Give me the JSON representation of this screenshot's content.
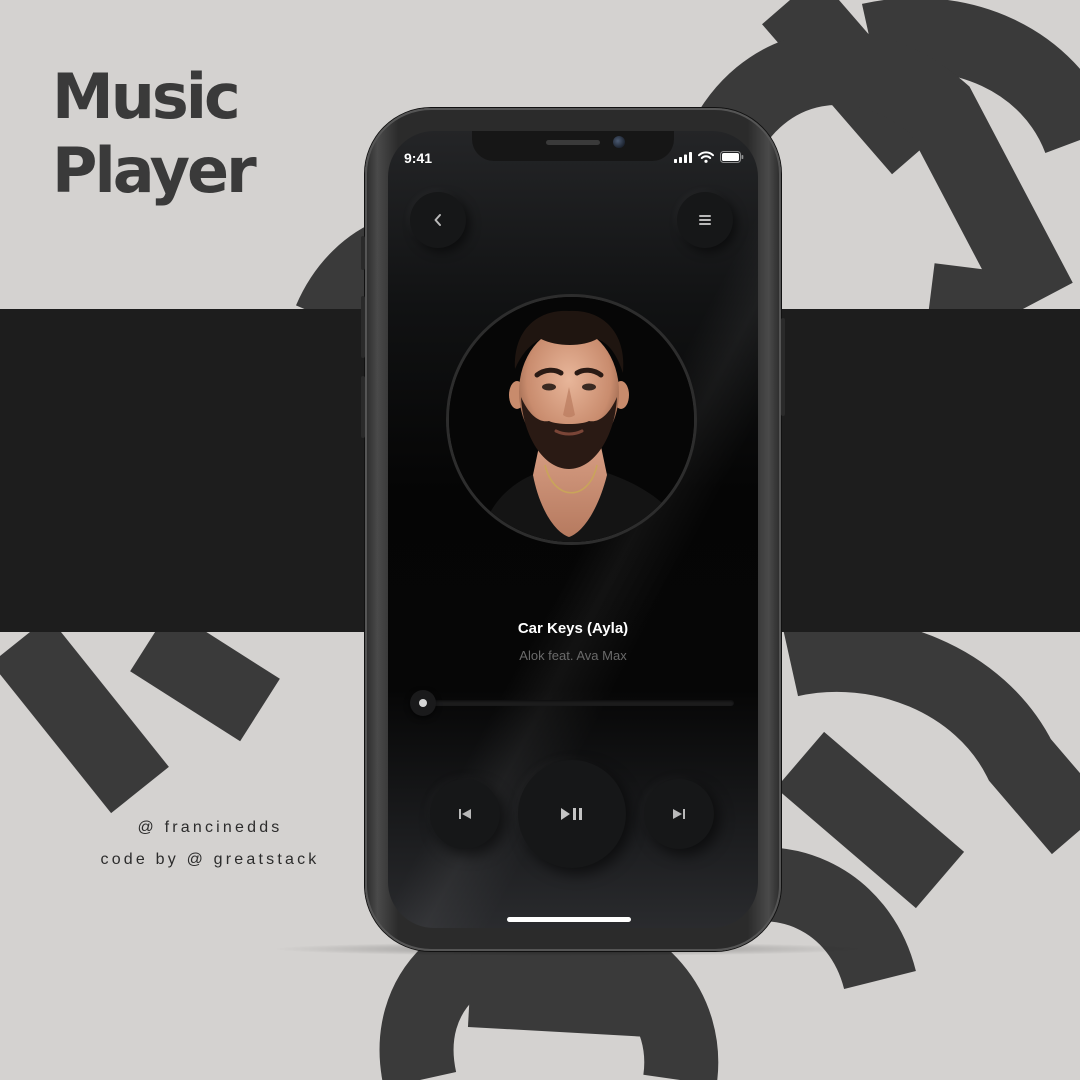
{
  "poster": {
    "title_line1": "Music",
    "title_line2": "Player",
    "credit_line1": "@ francinedds",
    "credit_line2": "code by @ greatstack"
  },
  "status_bar": {
    "time": "9:41",
    "icons": [
      "cellular-signal-icon",
      "wifi-icon",
      "battery-icon"
    ]
  },
  "header": {
    "back_icon": "chevron-left-icon",
    "menu_icon": "hamburger-menu-icon"
  },
  "track": {
    "title": "Car Keys (Ayla)",
    "artist": "Alok feat. Ava Max",
    "progress": 0
  },
  "controls": {
    "previous_icon": "skip-previous-icon",
    "play_pause_icon": "play-pause-icon",
    "next_icon": "skip-next-icon"
  },
  "colors": {
    "background": "#d4d2d0",
    "band": "#1d1d1d",
    "decor_letters": "#3a3a3a",
    "screen": "#0b0b0c",
    "text_primary": "#ffffff",
    "text_secondary": "#6a6a6a"
  }
}
